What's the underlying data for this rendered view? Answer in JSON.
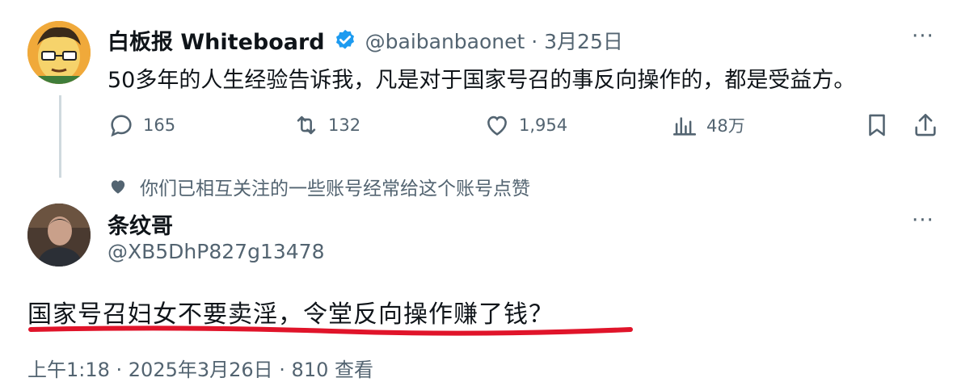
{
  "tweet": {
    "author_name": "白板报 Whiteboard",
    "handle_date": "@baibanbaonet · 3月25日",
    "text": "50多年的人生经验告诉我，凡是对于国家号召的事反向操作的，都是受益方。",
    "more": "···",
    "actions": {
      "reply_count": "165",
      "retweet_count": "132",
      "like_count": "1,954",
      "views_count": "48万"
    }
  },
  "social_context": "你们已相互关注的一些账号经常给这个账号点赞",
  "reply": {
    "author_name": "条纹哥",
    "handle": "@XB5DhP827g13478",
    "more": "···",
    "text": "国家号召妇女不要卖淫，令堂反向操作赚了钱？",
    "meta": "上午1:18 · 2025年3月26日 · 810 查看"
  },
  "colors": {
    "verified": "#1d9bf0",
    "secondary_text": "#536471",
    "underline": "#e0142a"
  }
}
